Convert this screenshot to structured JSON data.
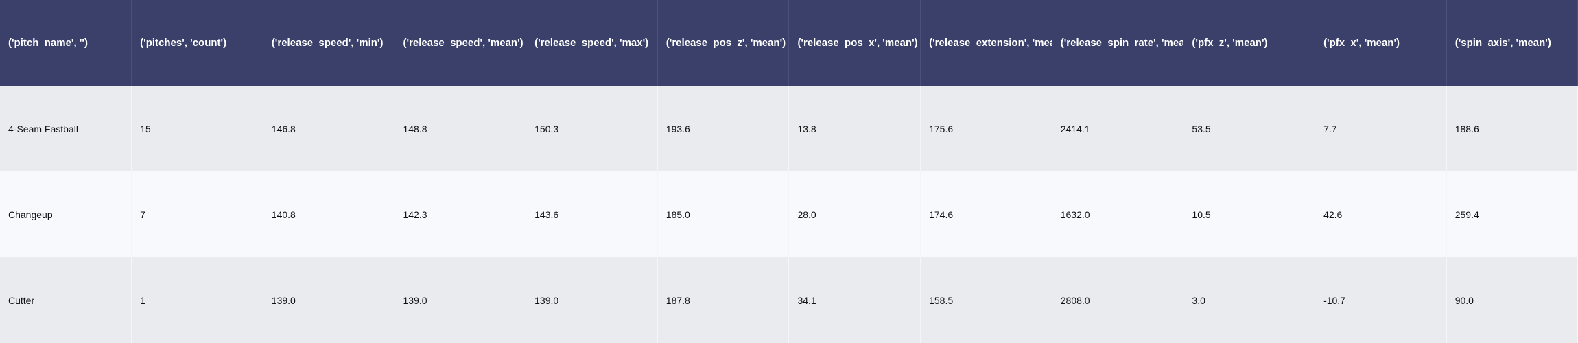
{
  "table": {
    "columns": [
      "('pitch_name', '')",
      "('pitches', 'count')",
      "('release_speed', 'min')",
      "('release_speed', 'mean')",
      "('release_speed', 'max')",
      "('release_pos_z', 'mean')",
      "('release_pos_x', 'mean')",
      "('release_extension', 'mean')",
      "('release_spin_rate', 'mean')",
      "('pfx_z', 'mean')",
      "('pfx_x', 'mean')",
      "('spin_axis', 'mean')"
    ],
    "rows": [
      [
        "4-Seam Fastball",
        "15",
        "146.8",
        "148.8",
        "150.3",
        "193.6",
        "13.8",
        "175.6",
        "2414.1",
        "53.5",
        "7.7",
        "188.6"
      ],
      [
        "Changeup",
        "7",
        "140.8",
        "142.3",
        "143.6",
        "185.0",
        "28.0",
        "174.6",
        "1632.0",
        "10.5",
        "42.6",
        "259.4"
      ],
      [
        "Cutter",
        "1",
        "139.0",
        "139.0",
        "139.0",
        "187.8",
        "34.1",
        "158.5",
        "2808.0",
        "3.0",
        "-10.7",
        "90.0"
      ]
    ]
  },
  "colors": {
    "header_bg": "#3a4069",
    "header_text": "#ffffff",
    "row_odd_bg": "#eaebef",
    "row_even_bg": "#f7f9fd"
  }
}
